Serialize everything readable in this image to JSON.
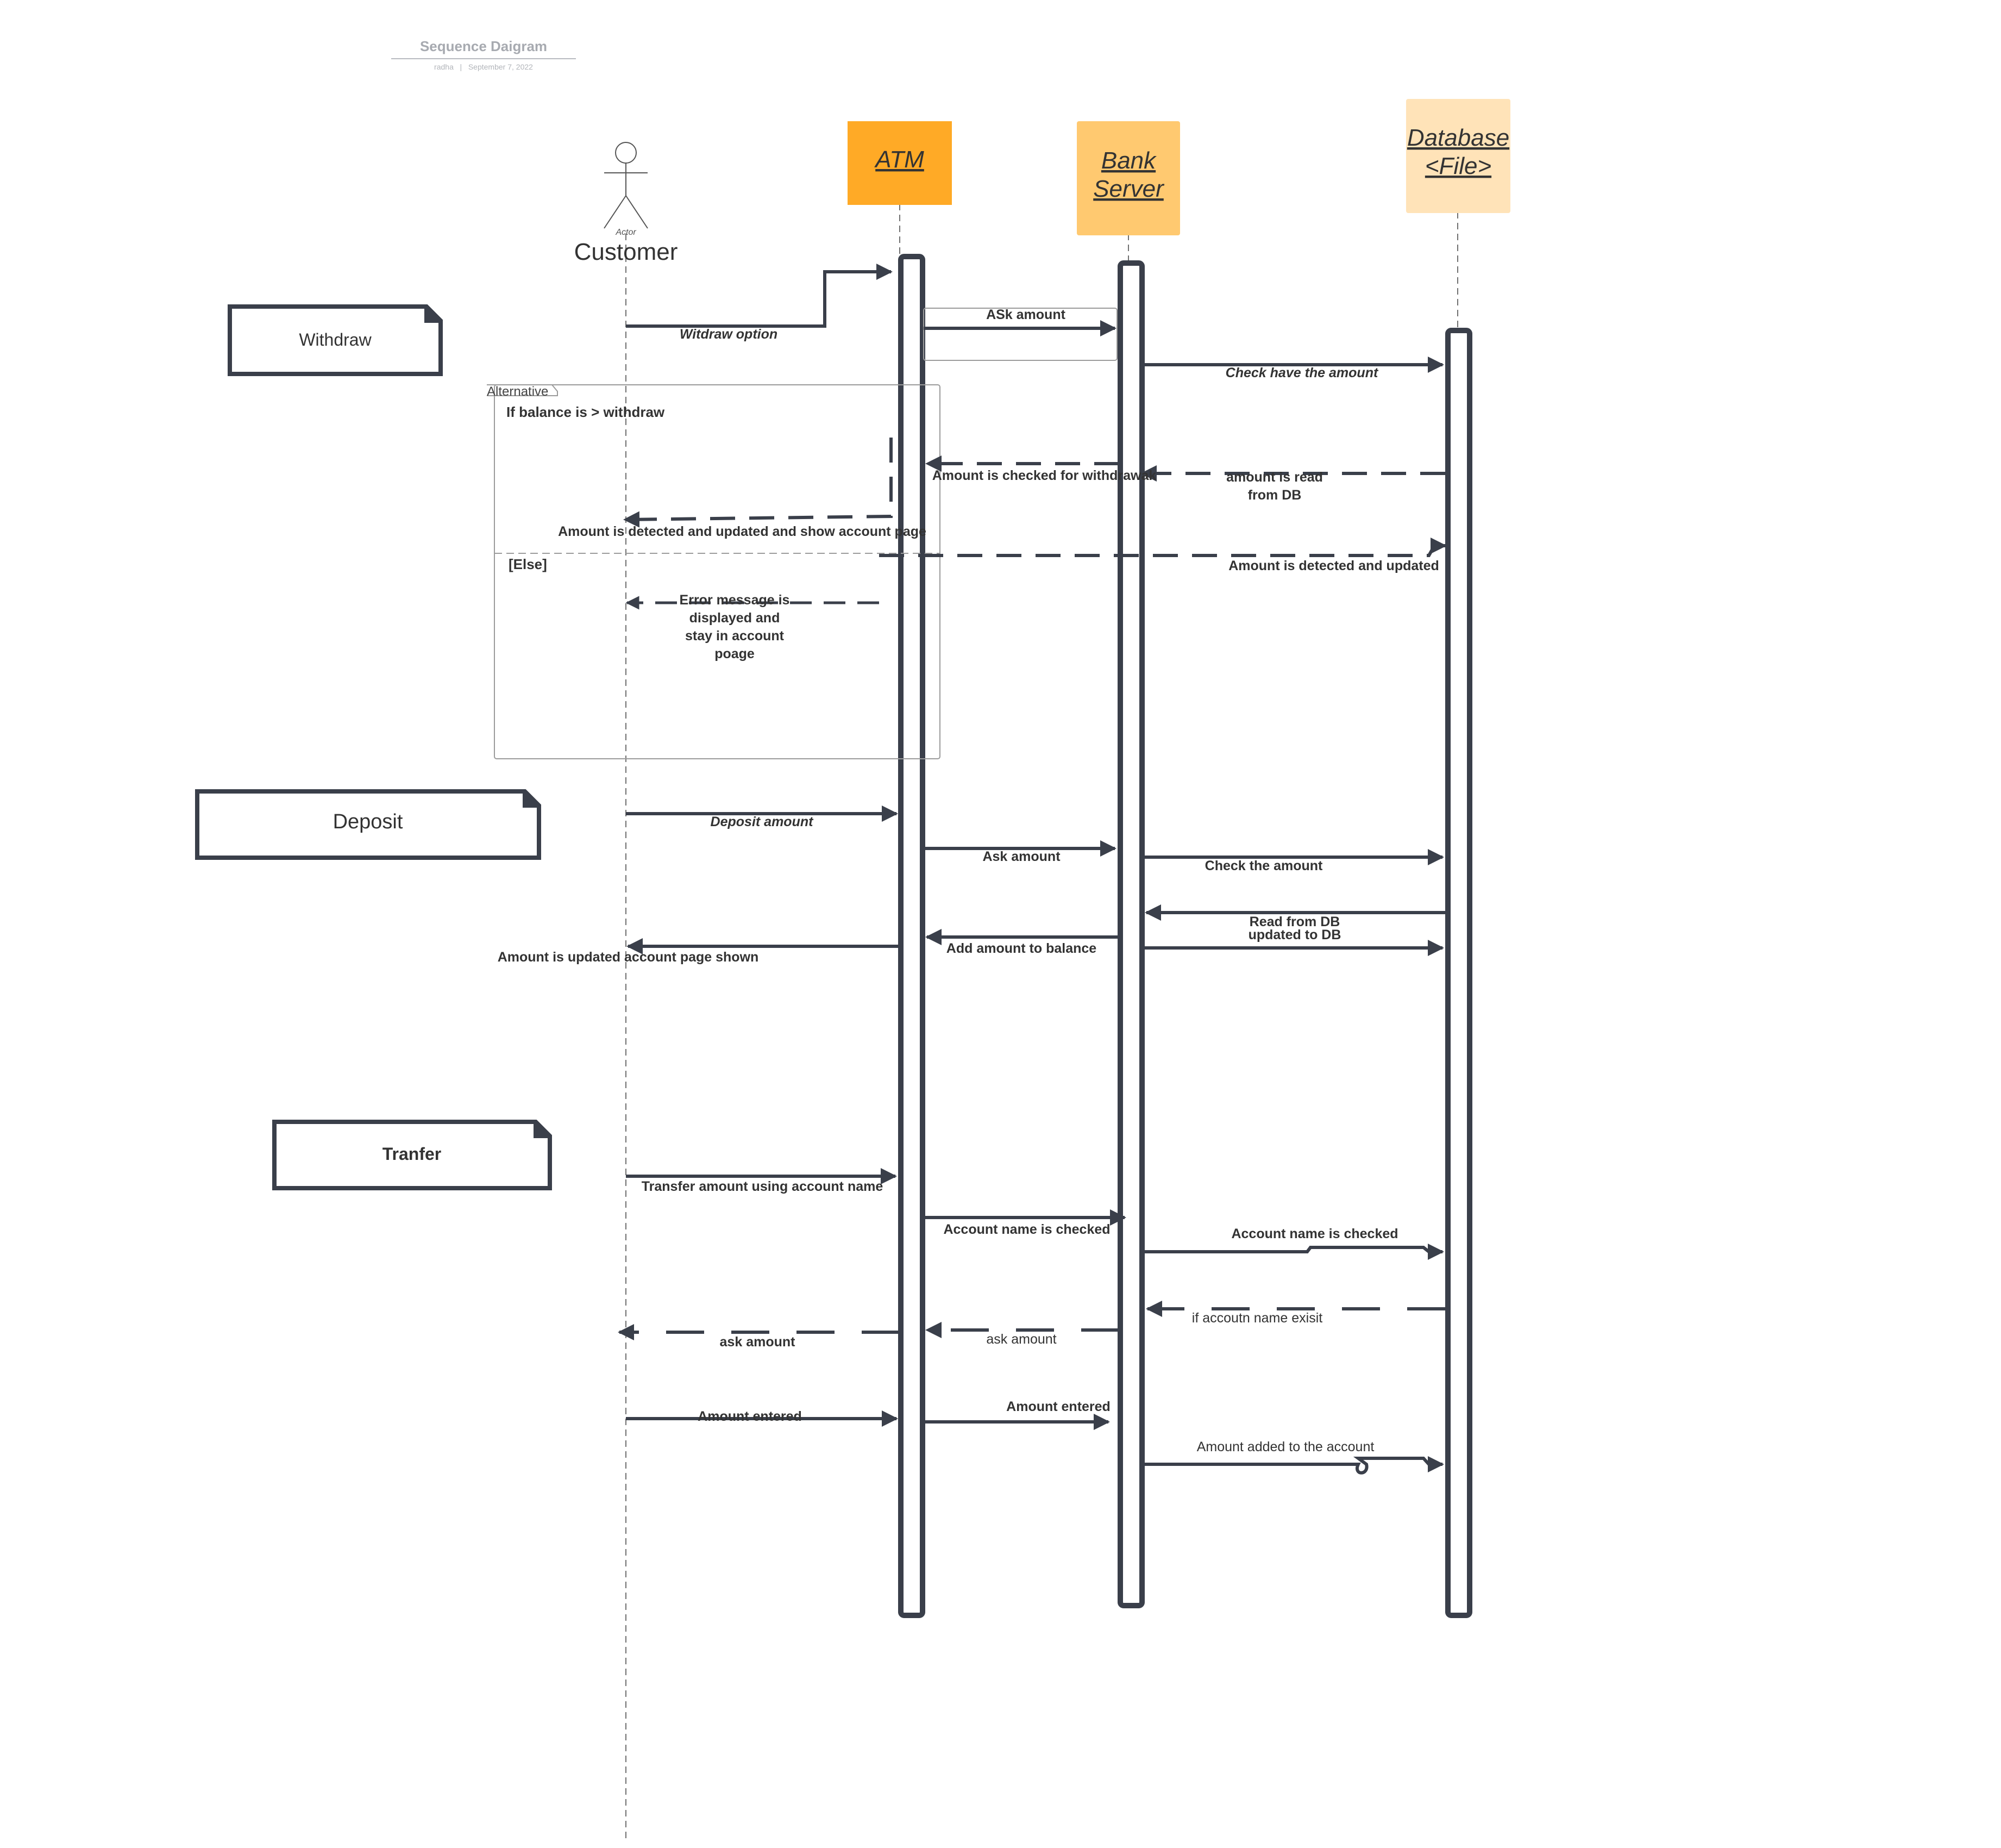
{
  "header": {
    "title": "Sequence Daigram",
    "author": "radha",
    "separator": "|",
    "date": "September 7, 2022"
  },
  "actor": {
    "caption": "Actor",
    "name": "Customer"
  },
  "participants": {
    "atm": "ATM",
    "bank_line1": "Bank",
    "bank_line2": "Server",
    "db_line1": "Database",
    "db_line2": "<File>"
  },
  "colors": {
    "atm": "#FFAA26",
    "bank": "#FFC970",
    "database": "#FFE3B8",
    "stroke": "#3A3F4A",
    "frame": "#9B9B9B"
  },
  "notes": {
    "withdraw": "Withdraw",
    "deposit": "Deposit",
    "transfer": "Tranfer"
  },
  "fragment": {
    "label": "Alternative",
    "guard": "If balance is > withdraw",
    "else": "[Else]"
  },
  "messages": {
    "withdraw_option": "Witdraw option",
    "ask_amount_1": "ASk amount",
    "check_have_amount": "Check have   the amount",
    "checked_for_withdraw": "Amount is checked for withdrawak",
    "read_from_db_l1": "amount is read",
    "read_from_db_l2": "from DB",
    "detected_updated_show": "Amount is detected and updated and show account page",
    "detected_updated": "Amount is detected and updated",
    "error_l1": "Error message is",
    "error_l2": "displayed and",
    "error_l3": "stay in account",
    "error_l4": "poage",
    "deposit_amount": "Deposit amount",
    "ask_amount_2": "Ask amount",
    "check_the_amount": "Check the amount",
    "read_from_db": "Read from DB",
    "updated_to_db": "updated to DB",
    "add_amount_balance": "Add amount to balance",
    "amount_updated_shown": "Amount is updated  account page shown",
    "transfer_using_name": "Transfer amount using  account name",
    "account_name_checked_1": "Account name  is  checked",
    "account_name_checked_2": "Account name  is  checked",
    "if_name_exist": "if accoutn name exisit",
    "ask_amount_3": "ask amount",
    "ask_amount_4": "ask amount",
    "amount_entered_1": "Amount entered",
    "amount_entered_2": "Amount entered",
    "amount_added": "Amount added to the account"
  }
}
